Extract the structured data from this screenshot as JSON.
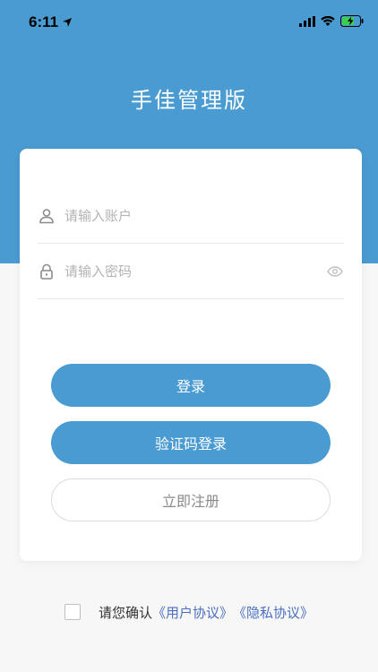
{
  "status_bar": {
    "time": "6:11"
  },
  "app": {
    "title": "手佳管理版"
  },
  "login_form": {
    "account_placeholder": "请输入账户",
    "password_placeholder": "请输入密码",
    "login_label": "登录",
    "sms_login_label": "验证码登录",
    "register_label": "立即注册"
  },
  "agreement": {
    "prefix": "请您确认",
    "user_agreement": "《用户协议》",
    "privacy_policy": "《隐私协议》"
  },
  "colors": {
    "brand": "#4a9bd1",
    "link": "#4a6fc2",
    "background": "#f7f7f7"
  }
}
